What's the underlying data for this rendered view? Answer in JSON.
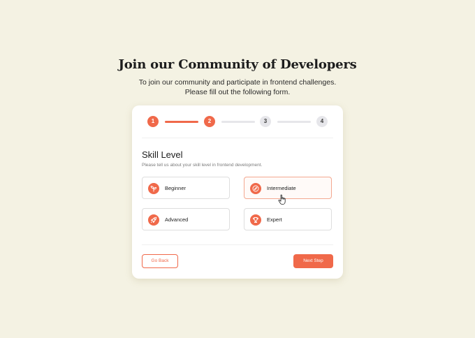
{
  "header": {
    "title": "Join our Community of Developers",
    "subtitle_line1": "To join our community and participate in frontend challenges.",
    "subtitle_line2": "Please fill out the following form."
  },
  "stepper": {
    "steps": [
      {
        "label": "1",
        "state": "active"
      },
      {
        "label": "2",
        "state": "active"
      },
      {
        "label": "3",
        "state": "inactive"
      },
      {
        "label": "4",
        "state": "inactive"
      }
    ],
    "current_step": 2
  },
  "form": {
    "section_title": "Skill Level",
    "section_description": "Please tell us about your skill level in frontend development.",
    "options": [
      {
        "label": "Beginner",
        "icon": "sprout-icon",
        "selected": false
      },
      {
        "label": "Intermediate",
        "icon": "compass-icon",
        "selected": true
      },
      {
        "label": "Advanced",
        "icon": "rocket-icon",
        "selected": false
      },
      {
        "label": "Expert",
        "icon": "trophy-icon",
        "selected": false
      }
    ]
  },
  "actions": {
    "back_label": "Go Back",
    "next_label": "Next Step"
  },
  "colors": {
    "background": "#f4f2e3",
    "accent": "#f0694a",
    "inactive": "#e6e6ea",
    "card": "#ffffff"
  }
}
